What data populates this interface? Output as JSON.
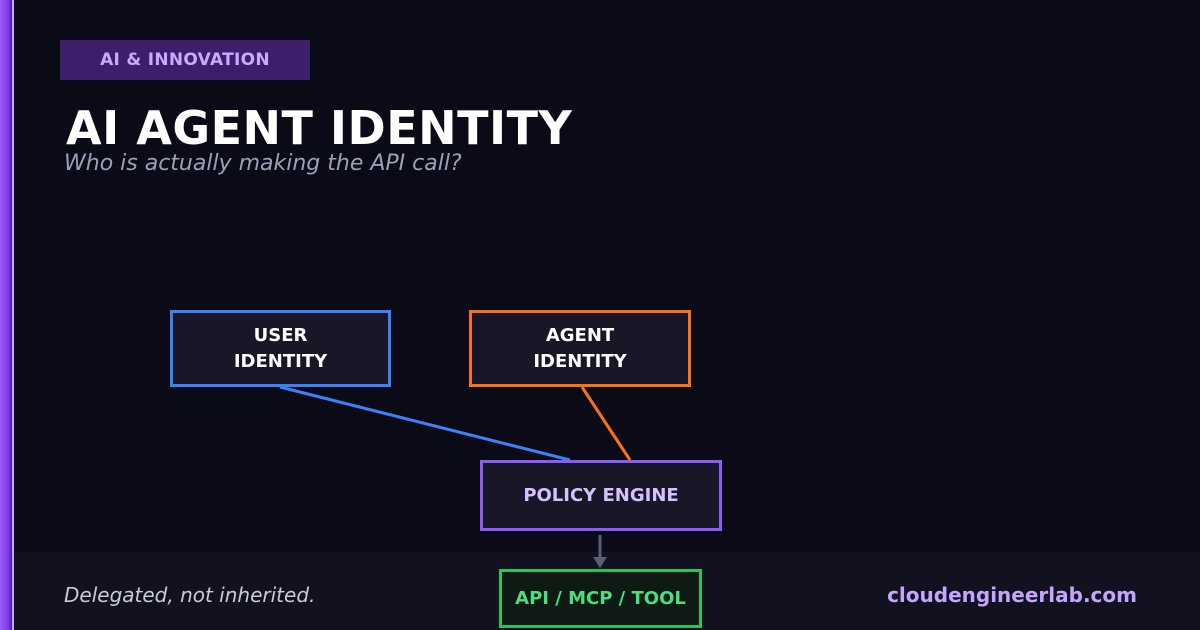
{
  "badge": {
    "label": "AI & INNOVATION"
  },
  "title": "AI AGENT IDENTITY",
  "subtitle": "Who is actually making the API call?",
  "diagram": {
    "nodes": {
      "user": {
        "line1": "USER",
        "line2": "IDENTITY",
        "color": "#3b82f6"
      },
      "agent": {
        "line1": "AGENT",
        "line2": "IDENTITY",
        "color": "#f97316"
      },
      "policy": {
        "label": "POLICY ENGINE",
        "color": "#8b5cf6"
      },
      "api": {
        "label": "API / MCP / TOOL",
        "color": "#22c55e"
      }
    },
    "edges": [
      {
        "from": "user",
        "to": "policy"
      },
      {
        "from": "agent",
        "to": "policy"
      },
      {
        "from": "policy",
        "to": "api",
        "arrow": true
      }
    ]
  },
  "footer": {
    "tagline": "Delegated, not inherited.",
    "site": "cloudengineerlab.com"
  },
  "colors": {
    "accent": "#8b5cf6",
    "background": "#0b0b17"
  }
}
